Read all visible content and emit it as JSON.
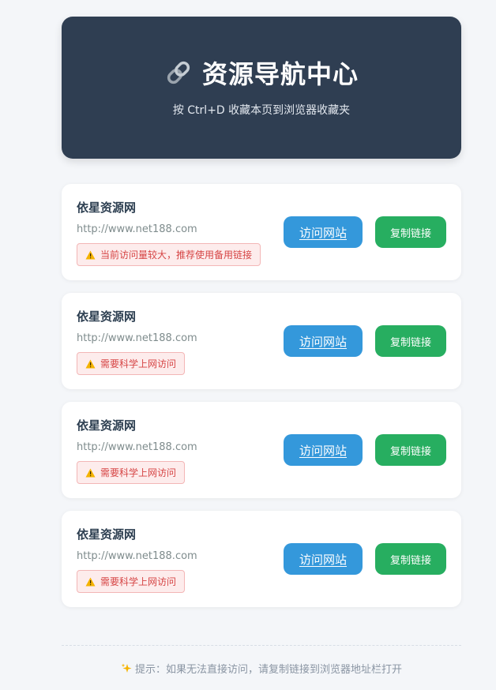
{
  "header": {
    "title": "资源导航中心",
    "subtitle": "按 Ctrl+D 收藏本页到浏览器收藏夹",
    "icon": "link-icon"
  },
  "sites": [
    {
      "name": "依星资源网",
      "url": "http://www.net188.com",
      "warning": "当前访问量较大，推荐使用备用链接",
      "visit_label": "访问网站",
      "copy_label": "复制链接"
    },
    {
      "name": "依星资源网",
      "url": "http://www.net188.com",
      "warning": "需要科学上网访问",
      "visit_label": "访问网站",
      "copy_label": "复制链接"
    },
    {
      "name": "依星资源网",
      "url": "http://www.net188.com",
      "warning": "需要科学上网访问",
      "visit_label": "访问网站",
      "copy_label": "复制链接"
    },
    {
      "name": "依星资源网",
      "url": "http://www.net188.com",
      "warning": "需要科学上网访问",
      "visit_label": "访问网站",
      "copy_label": "复制链接"
    }
  ],
  "footer": {
    "tip": "提示：如果无法直接访问，请复制链接到浏览器地址栏打开",
    "icon": "sparkles-icon"
  },
  "colors": {
    "header_bg": "#2f3e52",
    "visit_button": "#3498db",
    "copy_button": "#27ae60",
    "warning_text": "#d64545"
  }
}
